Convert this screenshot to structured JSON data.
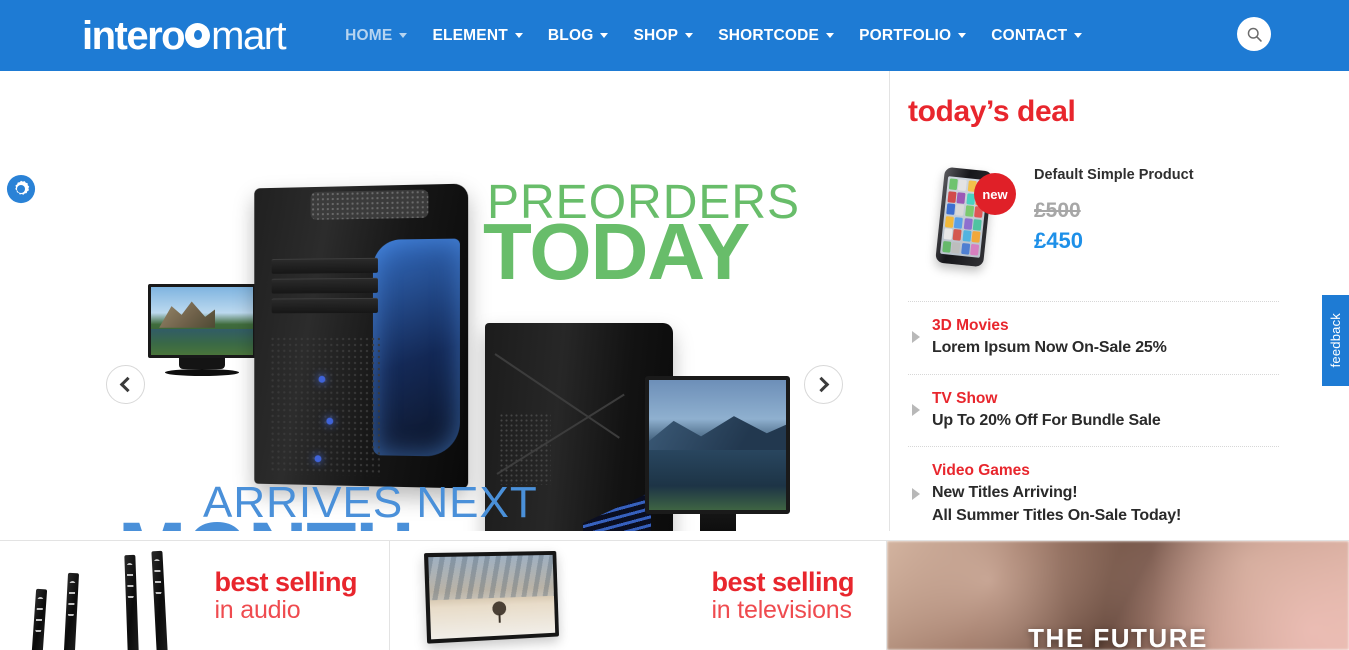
{
  "header": {
    "logo": {
      "bold_part": "intero",
      "dot_icon": "circle-dot-icon",
      "light_part": "mart"
    },
    "nav": [
      {
        "label": "HOME",
        "has_caret": true,
        "active": true
      },
      {
        "label": "ELEMENT",
        "has_caret": true,
        "active": false
      },
      {
        "label": "BLOG",
        "has_caret": true,
        "active": false
      },
      {
        "label": "SHOP",
        "has_caret": true,
        "active": false
      },
      {
        "label": "SHORTCODE",
        "has_caret": true,
        "active": false
      },
      {
        "label": "PORTFOLIO",
        "has_caret": true,
        "active": false
      },
      {
        "label": "CONTACT",
        "has_caret": true,
        "active": false
      }
    ],
    "search_icon": "search-icon",
    "bg_color": "#1e7bd4"
  },
  "side_widgets": {
    "settings_toggle_icon": "gear-icon",
    "feedback_tab_label": "feedback",
    "feedback_tab_color": "#1e7bd4"
  },
  "slider": {
    "prev_icon": "chevron-left-icon",
    "next_icon": "chevron-right-icon",
    "headline_line1": "PREORDERS",
    "headline_line2": "TODAY",
    "headline_line3": "ARRIVES NEXT",
    "headline_line4": "MONTH",
    "green_color": "#68bd6a",
    "blue_color": "#4a90d9"
  },
  "deal": {
    "title": "today’s deal",
    "title_color": "#e8262d",
    "feature": {
      "badge": "new",
      "badge_color": "#e02028",
      "product_name": "Default Simple Product",
      "old_price": "£500",
      "new_price": "£450",
      "new_price_color": "#1e90e8",
      "thumb_icon": "smartphone-icon"
    },
    "items": [
      {
        "category": "3D Movies",
        "lines": [
          "Lorem Ipsum Now On-Sale 25%"
        ]
      },
      {
        "category": "TV Show",
        "lines": [
          "Up To 20% Off For Bundle Sale"
        ]
      },
      {
        "category": "Video Games",
        "lines": [
          "New Titles Arriving!",
          "All Summer Titles On-Sale Today!"
        ]
      }
    ]
  },
  "promos": [
    {
      "bold": "best selling",
      "light": "in audio",
      "image_icon": "tower-speakers-icon"
    },
    {
      "bold": "best selling",
      "light": "in televisions",
      "image_icon": "television-icon"
    }
  ],
  "future_banner": {
    "text": "THE FUTURE"
  }
}
